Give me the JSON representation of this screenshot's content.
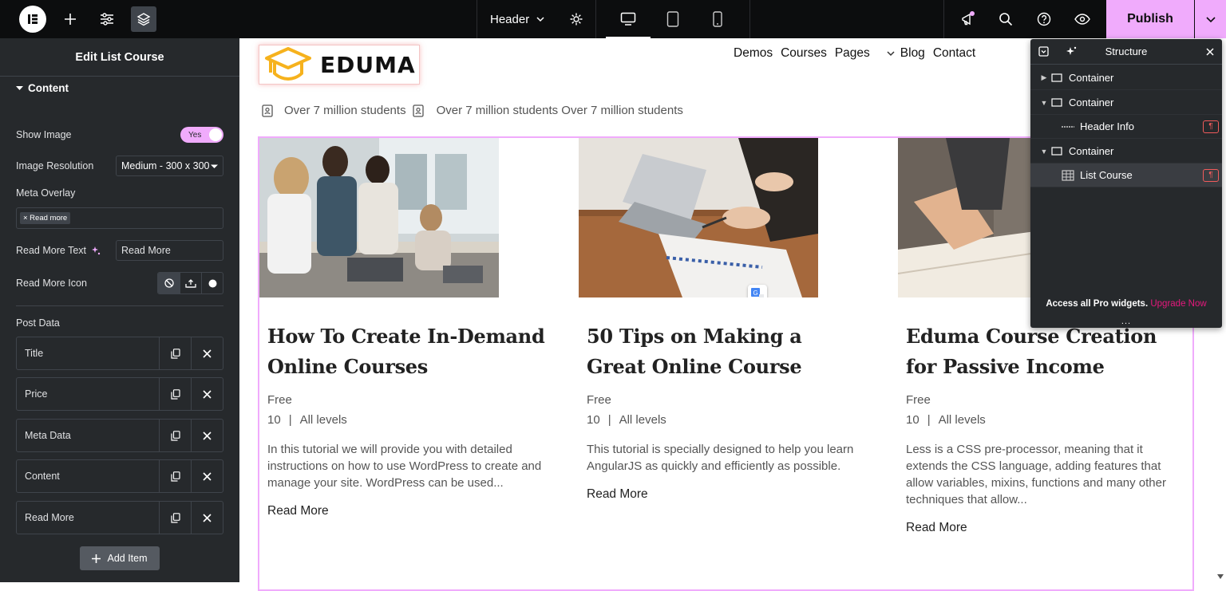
{
  "topbar": {
    "doc_name": "Header",
    "publish_label": "Publish"
  },
  "left_panel": {
    "title": "Edit List Course",
    "section_label": "Content",
    "show_image_label": "Show Image",
    "show_image_toggle": "Yes",
    "image_resolution_label": "Image Resolution",
    "image_resolution_value": "Medium - 300 x 300",
    "meta_overlay_label": "Meta Overlay",
    "meta_overlay_tag": "× Read more",
    "read_more_text_label": "Read More Text",
    "read_more_text_value": "Read More",
    "read_more_icon_label": "Read More Icon",
    "post_data_label": "Post Data",
    "post_data_items": [
      "Title",
      "Price",
      "Meta Data",
      "Content",
      "Read More"
    ],
    "add_item_label": "Add Item"
  },
  "canvas": {
    "logo_text": "EDUMA",
    "nav": [
      "Demos",
      "Courses",
      "Pages",
      "Blog",
      "Contact"
    ],
    "info_1": "Over 7 million students",
    "info_2": "Over 7 million students Over 7 million students",
    "courses": [
      {
        "title": "How To Create In-Demand Online Courses",
        "price": "Free",
        "lessons": "10",
        "level": "All levels",
        "excerpt": "In this tutorial we will provide you with detailed instructions on how to use WordPress to create and manage your site. WordPress can be used...",
        "read_more": "Read More"
      },
      {
        "title": "50 Tips on Making a Great Online Course",
        "price": "Free",
        "lessons": "10",
        "level": "All levels",
        "excerpt": "This tutorial is specially designed to help you learn AngularJS as quickly and efficiently as possible.",
        "read_more": "Read More"
      },
      {
        "title": "Eduma Course Creation for Passive Income",
        "price": "Free",
        "lessons": "10",
        "level": "All levels",
        "excerpt": "Less is a CSS pre-processor, meaning that it extends the CSS language, adding features that allow variables, mixins, functions and many other techniques that allow...",
        "read_more": "Read More"
      }
    ]
  },
  "structure": {
    "title": "Structure",
    "items": [
      "Container",
      "Container",
      "Header Info",
      "Container",
      "List Course"
    ],
    "footer_text": "Access all Pro widgets.",
    "upgrade_label": "Upgrade Now",
    "dots": "..."
  },
  "colors": {
    "accent": "#f0abfc",
    "panel_bg": "#26292c",
    "topbar_bg": "#0c0d0e",
    "upgrade": "#e6187d"
  }
}
